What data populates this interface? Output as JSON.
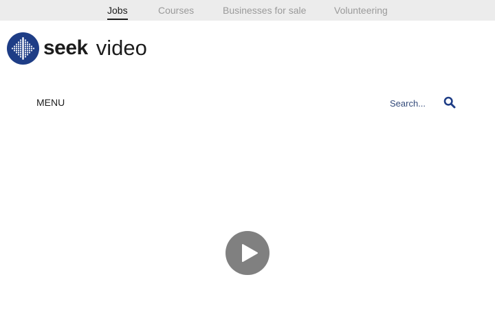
{
  "top_nav": {
    "items": [
      {
        "label": "Jobs",
        "active": true
      },
      {
        "label": "Courses",
        "active": false
      },
      {
        "label": "Businesses for sale",
        "active": false
      },
      {
        "label": "Volunteering",
        "active": false
      }
    ]
  },
  "logo": {
    "brand": "seek",
    "product": "video",
    "icon": "seek-logo-icon",
    "brand_color": "#1e3d86"
  },
  "header": {
    "menu_label": "MENU",
    "search": {
      "placeholder": "Search...",
      "value": "",
      "icon": "search-icon"
    }
  },
  "player": {
    "icon": "play-icon",
    "button_color": "#808080"
  },
  "colors": {
    "top_nav_background": "#ececec",
    "accent": "#1e3d86",
    "text_dark": "#1c1c1c",
    "text_muted": "#9a9a9a"
  }
}
